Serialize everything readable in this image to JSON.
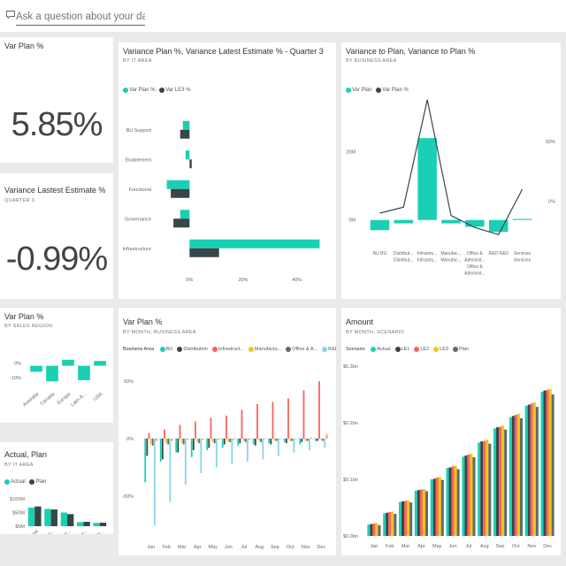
{
  "qa": {
    "placeholder": "Ask a question about your data"
  },
  "colors": {
    "teal": "#1bcfb4",
    "dark": "#374649",
    "red": "#fd625e",
    "yellow": "#f2c80f",
    "grey": "#5f6b6d",
    "blue": "#8ad4eb",
    "orange": "#fe9666",
    "pink": "#ef8ba1"
  },
  "kpi1": {
    "title": "Var Plan %",
    "value": "5.85%"
  },
  "kpi2": {
    "title": "Variance Lastest Estimate %",
    "subtitle": "QUARTER 3",
    "value": "-0.99%"
  },
  "tile3": {
    "title": "Variance Plan %, Variance Latest Estimate % - Quarter 3",
    "subtitle": "BY IT AREA",
    "legend": [
      "Var Plan %",
      "Var LE3 %"
    ],
    "chart_data": {
      "type": "bar",
      "orientation": "horizontal",
      "categories": [
        "BU Support",
        "Enablement",
        "Functional",
        "Governance",
        "Infrastructure"
      ],
      "series": [
        {
          "name": "Var Plan %",
          "values": [
            -2.5,
            -1.5,
            -8.5,
            -3.5,
            48.5
          ]
        },
        {
          "name": "Var LE3 %",
          "values": [
            -3.5,
            0.8,
            -7,
            -6,
            11
          ]
        }
      ],
      "xticks": [
        "0%",
        "20%",
        "40%"
      ],
      "xlim": [
        -10,
        50
      ]
    }
  },
  "tile4": {
    "title": "Variance to Plan, Variance to Plan %",
    "subtitle": "BY BUSINESS AREA",
    "legend": [
      "Var Plan",
      "Var Plan %"
    ],
    "chart_data": {
      "type": "bar",
      "categories": [
        "BU BU",
        "Distribut... Distribut...",
        "Infrastru... Infrastru...",
        "Manufac... Manufac...",
        "Office & Administ... Office & Administ...",
        "R&D R&D",
        "Services Services"
      ],
      "series": [
        {
          "name": "Var Plan",
          "values": [
            -3,
            -1,
            24,
            -1,
            -2,
            -3.5,
            0.3
          ]
        },
        {
          "name": "Var Plan %",
          "values": [
            -10,
            -5,
            85,
            -12,
            -22,
            -28,
            10
          ]
        }
      ],
      "yticks_left": [
        "20M",
        "0M"
      ],
      "yticks_right": [
        "50%",
        "0%"
      ],
      "ylim": [
        -5,
        30
      ],
      "ylim_right": [
        -30,
        70
      ]
    }
  },
  "tile5": {
    "title": "Var Plan %",
    "subtitle": "BY SALES REGION",
    "chart_data": {
      "type": "bar",
      "categories": [
        "Australia",
        "Canada",
        "Europe",
        "Latin A...",
        "USA"
      ],
      "values": [
        -5,
        -13,
        5,
        -12,
        4
      ],
      "yticks": [
        "0%",
        "-10%"
      ],
      "ylim": [
        -18,
        10
      ]
    }
  },
  "tile6": {
    "title": "Actual, Plan",
    "subtitle": "BY IT AREA",
    "legend": [
      "Actual",
      "Plan"
    ],
    "chart_data": {
      "type": "bar",
      "categories": [
        "Functional",
        "BU Sup...",
        "Infrastr...",
        "Governan...",
        "Enablem..."
      ],
      "series": [
        {
          "name": "Actual",
          "values": [
            68,
            63,
            50,
            15,
            12
          ]
        },
        {
          "name": "Plan",
          "values": [
            72,
            61,
            44,
            16,
            13
          ]
        }
      ],
      "yticks": [
        "$100M",
        "$50M",
        "$0M"
      ],
      "ylim": [
        0,
        100
      ]
    }
  },
  "tile7": {
    "title": "Var Plan %",
    "subtitle": "BY MONTH, BUSINESS AREA",
    "legend_label": "Business Area",
    "legend": [
      "BU",
      "Distribution",
      "Infrastruct...",
      "Manufactu...",
      "Office & A...",
      "R&D",
      "Services"
    ],
    "chart_data": {
      "type": "bar",
      "categories": [
        "Jan",
        "Feb",
        "Mar",
        "Apr",
        "May",
        "Jun",
        "Jul",
        "Aug",
        "Sep",
        "Oct",
        "Nov",
        "Dec"
      ],
      "series": [
        {
          "name": "BU",
          "values": [
            -38,
            -20,
            -12,
            -16,
            -10,
            -8,
            -6,
            -5,
            -4,
            -3,
            -5,
            -2
          ]
        },
        {
          "name": "Distribution",
          "values": [
            -15,
            -18,
            -12,
            -10,
            -8,
            -5,
            -4,
            -6,
            -5,
            -4,
            -3,
            -2
          ]
        },
        {
          "name": "Infrastructure",
          "values": [
            5,
            8,
            12,
            15,
            18,
            20,
            25,
            30,
            32,
            35,
            42,
            50
          ]
        },
        {
          "name": "Manufacturing",
          "values": [
            -5,
            -4,
            -4,
            -3,
            -3,
            -3,
            -2,
            -2,
            -2,
            -2,
            -2,
            -1
          ]
        },
        {
          "name": "Office & Administration",
          "values": [
            -6,
            -5,
            -5,
            -4,
            -4,
            -3,
            -3,
            -3,
            -2,
            -2,
            -2,
            -2
          ]
        },
        {
          "name": "R&D",
          "values": [
            -75,
            -55,
            -40,
            -30,
            -25,
            -22,
            -20,
            -18,
            -15,
            -12,
            -10,
            -8
          ]
        },
        {
          "name": "Services",
          "values": [
            -2,
            -2,
            -1,
            -1,
            -1,
            -1,
            -1,
            0,
            0,
            0,
            1,
            4
          ]
        }
      ],
      "yticks": [
        "50%",
        "0%",
        "-50%"
      ],
      "ylim": [
        -80,
        60
      ]
    }
  },
  "tile8": {
    "title": "Amount",
    "subtitle": "BY MONTH, SCENARIO",
    "legend_label": "Scenario",
    "legend": [
      "Actual",
      "LE1",
      "LE2",
      "LE3",
      "Plan"
    ],
    "chart_data": {
      "type": "bar",
      "categories": [
        "Jan",
        "Feb",
        "Mar",
        "Apr",
        "May",
        "Jun",
        "Jul",
        "Aug",
        "Sep",
        "Oct",
        "Nov",
        "Dec"
      ],
      "series": [
        {
          "name": "Actual",
          "values": [
            0.02,
            0.04,
            0.06,
            0.08,
            0.1,
            0.12,
            0.14,
            0.165,
            0.19,
            0.21,
            0.23,
            0.255
          ]
        },
        {
          "name": "LE1",
          "values": [
            0.021,
            0.041,
            0.061,
            0.081,
            0.101,
            0.121,
            0.142,
            0.167,
            0.192,
            0.212,
            0.232,
            0.257
          ]
        },
        {
          "name": "LE2",
          "values": [
            0.022,
            0.042,
            0.062,
            0.082,
            0.103,
            0.123,
            0.144,
            0.168,
            0.193,
            0.214,
            0.234,
            0.258
          ]
        },
        {
          "name": "LE3",
          "values": [
            0.023,
            0.043,
            0.063,
            0.083,
            0.104,
            0.124,
            0.145,
            0.17,
            0.195,
            0.216,
            0.236,
            0.26
          ]
        },
        {
          "name": "Plan",
          "values": [
            0.019,
            0.039,
            0.059,
            0.079,
            0.099,
            0.118,
            0.139,
            0.163,
            0.188,
            0.208,
            0.228,
            0.25
          ]
        }
      ],
      "yticks": [
        "$0.3bn",
        "$0.2bn",
        "$0.1bn",
        "$0.0bn"
      ],
      "ylim": [
        0,
        0.3
      ]
    }
  }
}
